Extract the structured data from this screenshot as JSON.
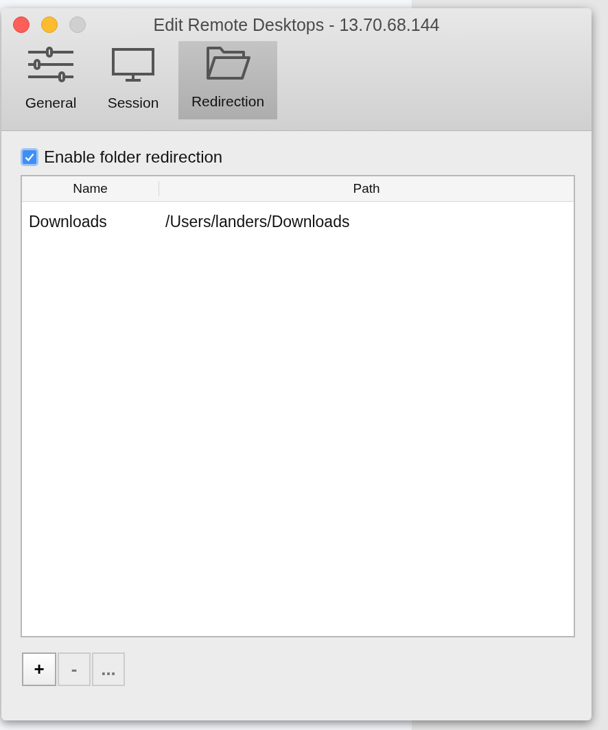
{
  "window": {
    "title": "Edit Remote Desktops - 13.70.68.144"
  },
  "tabs": [
    {
      "label": "General",
      "kind": "sliders",
      "selected": false
    },
    {
      "label": "Session",
      "kind": "monitor",
      "selected": false
    },
    {
      "label": "Redirection",
      "kind": "folder",
      "selected": true
    }
  ],
  "enable_redirection": {
    "label": "Enable folder redirection",
    "checked": true
  },
  "table": {
    "columns": [
      "Name",
      "Path"
    ],
    "rows": [
      {
        "name": "Downloads",
        "path": "/Users/landers/Downloads"
      }
    ]
  },
  "buttons": [
    {
      "label": "+",
      "disabled": false
    },
    {
      "label": "-",
      "disabled": true
    },
    {
      "label": "...",
      "disabled": true
    }
  ]
}
